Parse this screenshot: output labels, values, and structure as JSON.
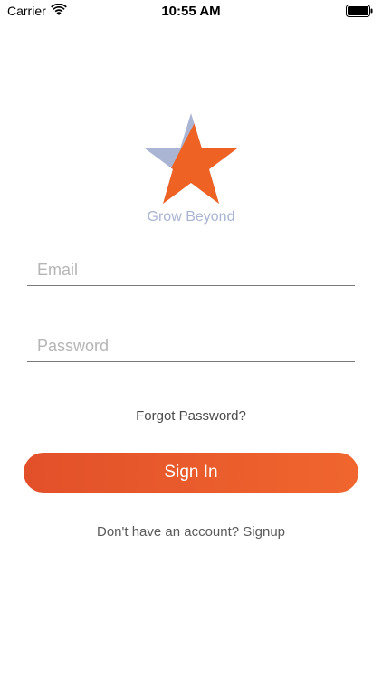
{
  "status_bar": {
    "carrier": "Carrier",
    "time": "10:55 AM",
    "icons": [
      "wifi-icon",
      "battery-icon"
    ]
  },
  "logo": {
    "icon": "star-logo-icon",
    "brand_name": "Grow Beyond",
    "colors": {
      "left_half": "#aab5d4",
      "right_half": "#ee6324",
      "brand_text": "#a9b4d1"
    }
  },
  "form": {
    "email_placeholder": "Email",
    "email_value": "",
    "password_placeholder": "Password",
    "password_value": "",
    "forgot_password": "Forgot Password?",
    "sign_in_label": "Sign In",
    "signup_prompt": "Don't have an account? Signup"
  },
  "colors": {
    "accent_start": "#e2502a",
    "accent_end": "#f0662e",
    "field_underline": "#7a7a7a",
    "placeholder": "#b5b5b5"
  }
}
